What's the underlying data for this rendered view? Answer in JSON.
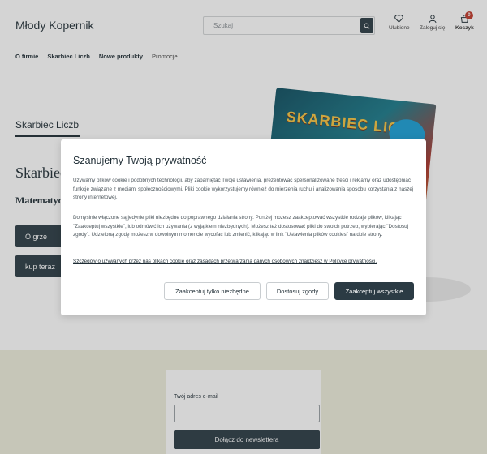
{
  "header": {
    "logo": "Młody Kopernik",
    "search_placeholder": "Szukaj",
    "favorites_label": "Ulubione",
    "login_label": "Zaloguj się",
    "cart_label": "Koszyk",
    "cart_count": "0"
  },
  "nav": {
    "items": [
      "O firmie",
      "Skarbiec Liczb",
      "Nowe produkty",
      "Promocje"
    ]
  },
  "hero": {
    "breadcrumb_title": "Skarbiec Liczb",
    "heading": "Skarbiec",
    "subheading": "Matematyc",
    "button_about": "O grze",
    "button_buy": "kup teraz",
    "product_box_title": "SKARBIEC LICZB"
  },
  "modal": {
    "title": "Szanujemy Twoją prywatność",
    "paragraph1": "Używamy plików cookie i podobnych technologii, aby zapamiętać Twoje ustawienia, prezentować spersonalizowane treści i reklamy oraz udostępniać funkcje związane z mediami społecznościowymi. Pliki cookie wykorzystujemy również do mierzenia ruchu i analizowania sposobu korzystania z naszej strony internetowej.",
    "paragraph2": "Domyślnie włączone są jedynie pliki niezbędne do poprawnego działania strony. Poniżej możesz zaakceptować wszystkie rodzaje plików, klikając \"Zaakceptuj wszystkie\", lub odmówić ich używania (z wyjątkiem niezbędnych). Możesz też dostosować pliki do swoich potrzeb, wybierając \"Dostosuj zgody\". Udzieloną zgodę możesz w dowolnym momencie wycofać lub zmienić, klikając w link \"Ustawienia plików cookies\" na dole strony.",
    "details_link": "Szczegóły o używanych przez nas plikach cookie oraz zasadach przetwarzania danych osobowych znajdziesz w Polityce prywatności.",
    "btn_necessary": "Zaakceptuj tylko niezbędne",
    "btn_customize": "Dostosuj zgody",
    "btn_accept_all": "Zaakceptuj wszystkie"
  },
  "newsletter": {
    "email_label": "Twój adres e-mail",
    "join_button": "Dołącz do newslettera"
  },
  "colors": {
    "primary": "#2b3b44",
    "newsletter_bg": "#ededdb",
    "badge": "#c0392b"
  }
}
